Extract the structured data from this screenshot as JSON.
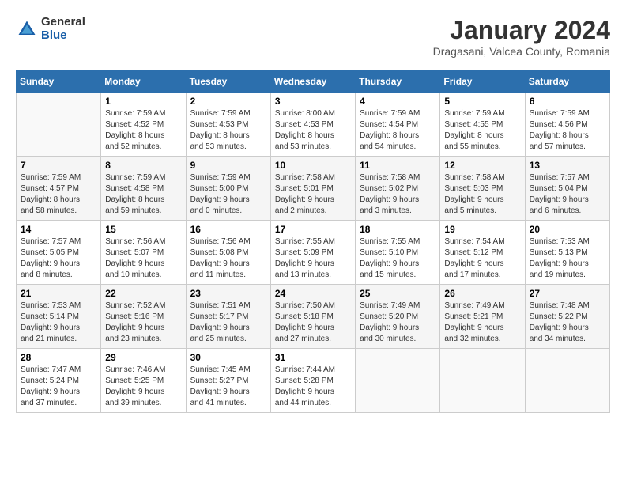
{
  "header": {
    "logo_general": "General",
    "logo_blue": "Blue",
    "month_title": "January 2024",
    "location": "Dragasani, Valcea County, Romania"
  },
  "weekdays": [
    "Sunday",
    "Monday",
    "Tuesday",
    "Wednesday",
    "Thursday",
    "Friday",
    "Saturday"
  ],
  "weeks": [
    [
      {
        "day": "",
        "info": ""
      },
      {
        "day": "1",
        "info": "Sunrise: 7:59 AM\nSunset: 4:52 PM\nDaylight: 8 hours\nand 52 minutes."
      },
      {
        "day": "2",
        "info": "Sunrise: 7:59 AM\nSunset: 4:53 PM\nDaylight: 8 hours\nand 53 minutes."
      },
      {
        "day": "3",
        "info": "Sunrise: 8:00 AM\nSunset: 4:53 PM\nDaylight: 8 hours\nand 53 minutes."
      },
      {
        "day": "4",
        "info": "Sunrise: 7:59 AM\nSunset: 4:54 PM\nDaylight: 8 hours\nand 54 minutes."
      },
      {
        "day": "5",
        "info": "Sunrise: 7:59 AM\nSunset: 4:55 PM\nDaylight: 8 hours\nand 55 minutes."
      },
      {
        "day": "6",
        "info": "Sunrise: 7:59 AM\nSunset: 4:56 PM\nDaylight: 8 hours\nand 57 minutes."
      }
    ],
    [
      {
        "day": "7",
        "info": "Sunrise: 7:59 AM\nSunset: 4:57 PM\nDaylight: 8 hours\nand 58 minutes."
      },
      {
        "day": "8",
        "info": "Sunrise: 7:59 AM\nSunset: 4:58 PM\nDaylight: 8 hours\nand 59 minutes."
      },
      {
        "day": "9",
        "info": "Sunrise: 7:59 AM\nSunset: 5:00 PM\nDaylight: 9 hours\nand 0 minutes."
      },
      {
        "day": "10",
        "info": "Sunrise: 7:58 AM\nSunset: 5:01 PM\nDaylight: 9 hours\nand 2 minutes."
      },
      {
        "day": "11",
        "info": "Sunrise: 7:58 AM\nSunset: 5:02 PM\nDaylight: 9 hours\nand 3 minutes."
      },
      {
        "day": "12",
        "info": "Sunrise: 7:58 AM\nSunset: 5:03 PM\nDaylight: 9 hours\nand 5 minutes."
      },
      {
        "day": "13",
        "info": "Sunrise: 7:57 AM\nSunset: 5:04 PM\nDaylight: 9 hours\nand 6 minutes."
      }
    ],
    [
      {
        "day": "14",
        "info": "Sunrise: 7:57 AM\nSunset: 5:05 PM\nDaylight: 9 hours\nand 8 minutes."
      },
      {
        "day": "15",
        "info": "Sunrise: 7:56 AM\nSunset: 5:07 PM\nDaylight: 9 hours\nand 10 minutes."
      },
      {
        "day": "16",
        "info": "Sunrise: 7:56 AM\nSunset: 5:08 PM\nDaylight: 9 hours\nand 11 minutes."
      },
      {
        "day": "17",
        "info": "Sunrise: 7:55 AM\nSunset: 5:09 PM\nDaylight: 9 hours\nand 13 minutes."
      },
      {
        "day": "18",
        "info": "Sunrise: 7:55 AM\nSunset: 5:10 PM\nDaylight: 9 hours\nand 15 minutes."
      },
      {
        "day": "19",
        "info": "Sunrise: 7:54 AM\nSunset: 5:12 PM\nDaylight: 9 hours\nand 17 minutes."
      },
      {
        "day": "20",
        "info": "Sunrise: 7:53 AM\nSunset: 5:13 PM\nDaylight: 9 hours\nand 19 minutes."
      }
    ],
    [
      {
        "day": "21",
        "info": "Sunrise: 7:53 AM\nSunset: 5:14 PM\nDaylight: 9 hours\nand 21 minutes."
      },
      {
        "day": "22",
        "info": "Sunrise: 7:52 AM\nSunset: 5:16 PM\nDaylight: 9 hours\nand 23 minutes."
      },
      {
        "day": "23",
        "info": "Sunrise: 7:51 AM\nSunset: 5:17 PM\nDaylight: 9 hours\nand 25 minutes."
      },
      {
        "day": "24",
        "info": "Sunrise: 7:50 AM\nSunset: 5:18 PM\nDaylight: 9 hours\nand 27 minutes."
      },
      {
        "day": "25",
        "info": "Sunrise: 7:49 AM\nSunset: 5:20 PM\nDaylight: 9 hours\nand 30 minutes."
      },
      {
        "day": "26",
        "info": "Sunrise: 7:49 AM\nSunset: 5:21 PM\nDaylight: 9 hours\nand 32 minutes."
      },
      {
        "day": "27",
        "info": "Sunrise: 7:48 AM\nSunset: 5:22 PM\nDaylight: 9 hours\nand 34 minutes."
      }
    ],
    [
      {
        "day": "28",
        "info": "Sunrise: 7:47 AM\nSunset: 5:24 PM\nDaylight: 9 hours\nand 37 minutes."
      },
      {
        "day": "29",
        "info": "Sunrise: 7:46 AM\nSunset: 5:25 PM\nDaylight: 9 hours\nand 39 minutes."
      },
      {
        "day": "30",
        "info": "Sunrise: 7:45 AM\nSunset: 5:27 PM\nDaylight: 9 hours\nand 41 minutes."
      },
      {
        "day": "31",
        "info": "Sunrise: 7:44 AM\nSunset: 5:28 PM\nDaylight: 9 hours\nand 44 minutes."
      },
      {
        "day": "",
        "info": ""
      },
      {
        "day": "",
        "info": ""
      },
      {
        "day": "",
        "info": ""
      }
    ]
  ]
}
